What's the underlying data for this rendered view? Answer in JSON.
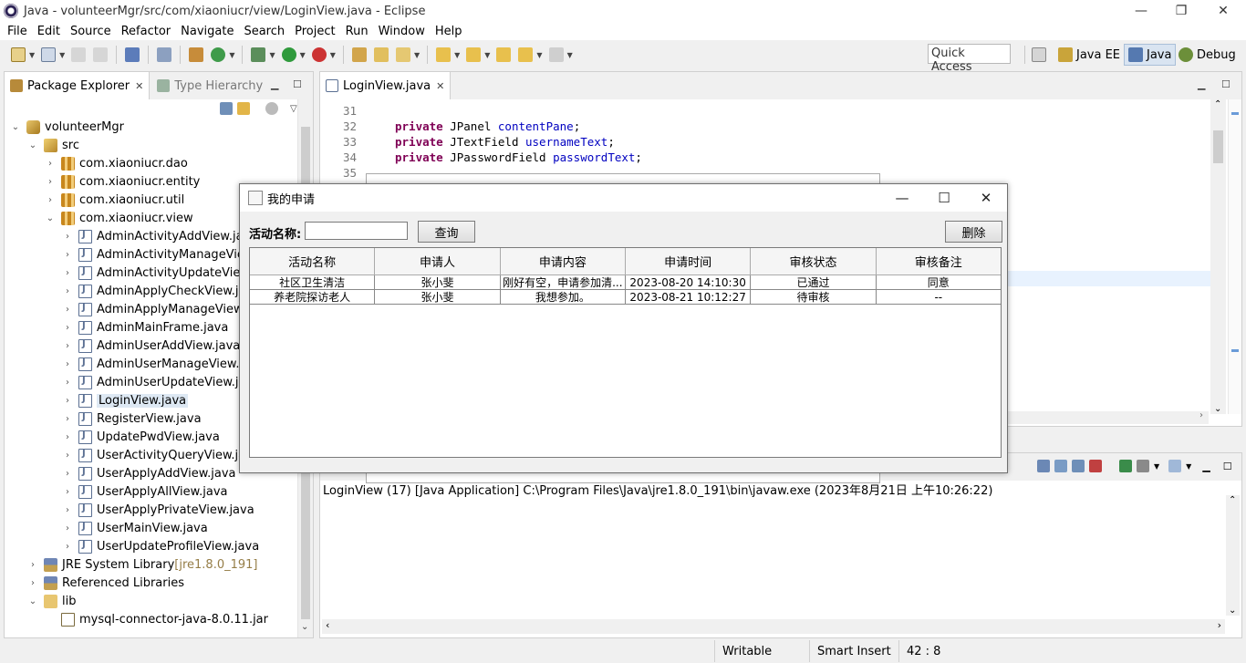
{
  "window": {
    "title": "Java - volunteerMgr/src/com/xiaoniucr/view/LoginView.java - Eclipse",
    "minimize": "—",
    "restore": "❐",
    "close": "✕"
  },
  "menu": [
    "File",
    "Edit",
    "Source",
    "Refactor",
    "Navigate",
    "Search",
    "Project",
    "Run",
    "Window",
    "Help"
  ],
  "toolbar": {
    "quick_access": "Quick Access",
    "perspectives": [
      "Java EE",
      "Java",
      "Debug"
    ]
  },
  "explorer": {
    "tab_active": "Package Explorer",
    "tab_inactive": "Type Hierarchy",
    "nodes": [
      {
        "label": "volunteerMgr",
        "toggle": "⌄",
        "icon": "project-icon"
      },
      {
        "label": "src",
        "toggle": "⌄",
        "icon": "source-folder-icon"
      },
      {
        "label": "com.xiaoniucr.dao",
        "toggle": "›",
        "icon": "package-icon"
      },
      {
        "label": "com.xiaoniucr.entity",
        "toggle": "›",
        "icon": "package-icon"
      },
      {
        "label": "com.xiaoniucr.util",
        "toggle": "›",
        "icon": "package-icon"
      },
      {
        "label": "com.xiaoniucr.view",
        "toggle": "⌄",
        "icon": "package-icon"
      },
      {
        "label": "AdminActivityAddView.java",
        "toggle": "›",
        "icon": "java-file-icon"
      },
      {
        "label": "AdminActivityManageView.java",
        "toggle": "›",
        "icon": "java-file-icon"
      },
      {
        "label": "AdminActivityUpdateView.java",
        "toggle": "›",
        "icon": "java-file-icon"
      },
      {
        "label": "AdminApplyCheckView.java",
        "toggle": "›",
        "icon": "java-file-icon"
      },
      {
        "label": "AdminApplyManageView.java",
        "toggle": "›",
        "icon": "java-file-icon"
      },
      {
        "label": "AdminMainFrame.java",
        "toggle": "›",
        "icon": "java-file-icon"
      },
      {
        "label": "AdminUserAddView.java",
        "toggle": "›",
        "icon": "java-file-icon"
      },
      {
        "label": "AdminUserManageView.java",
        "toggle": "›",
        "icon": "java-file-icon"
      },
      {
        "label": "AdminUserUpdateView.java",
        "toggle": "›",
        "icon": "java-file-icon"
      },
      {
        "label": "LoginView.java",
        "toggle": "›",
        "icon": "java-file-icon",
        "selected": true
      },
      {
        "label": "RegisterView.java",
        "toggle": "›",
        "icon": "java-file-icon"
      },
      {
        "label": "UpdatePwdView.java",
        "toggle": "›",
        "icon": "java-file-icon"
      },
      {
        "label": "UserActivityQueryView.java",
        "toggle": "›",
        "icon": "java-file-icon"
      },
      {
        "label": "UserApplyAddView.java",
        "toggle": "›",
        "icon": "java-file-icon"
      },
      {
        "label": "UserApplyAllView.java",
        "toggle": "›",
        "icon": "java-file-icon"
      },
      {
        "label": "UserApplyPrivateView.java",
        "toggle": "›",
        "icon": "java-file-icon"
      },
      {
        "label": "UserMainView.java",
        "toggle": "›",
        "icon": "java-file-icon"
      },
      {
        "label": "UserUpdateProfileView.java",
        "toggle": "›",
        "icon": "java-file-icon"
      },
      {
        "label": "JRE System Library",
        "suffix": " [jre1.8.0_191]",
        "toggle": "›",
        "icon": "library-icon"
      },
      {
        "label": "Referenced Libraries",
        "toggle": "›",
        "icon": "library-icon"
      },
      {
        "label": "lib",
        "toggle": "⌄",
        "icon": "folder-icon"
      },
      {
        "label": "mysql-connector-java-8.0.11.jar",
        "toggle": "",
        "icon": "jar-icon"
      }
    ]
  },
  "editor": {
    "tab": "LoginView.java",
    "lines": [
      {
        "num": "31",
        "kw": "",
        "type": "",
        "field": ""
      },
      {
        "num": "32",
        "kw": "private",
        "type": " JPanel ",
        "field": "contentPane",
        "end": ";"
      },
      {
        "num": "33",
        "kw": "private",
        "type": " JTextField ",
        "field": "usernameText",
        "end": ";"
      },
      {
        "num": "34",
        "kw": "private",
        "type": " JPasswordField ",
        "field": "passwordText",
        "end": ";"
      },
      {
        "num": "35",
        "kw": "",
        "type": "",
        "field": "",
        "end": ""
      }
    ]
  },
  "console": {
    "header": "LoginView (17) [Java Application] C:\\Program Files\\Java\\jre1.8.0_191\\bin\\javaw.exe (2023年8月21日 上午10:26:22)"
  },
  "status": {
    "writable": "Writable",
    "insert_mode": "Smart Insert",
    "position": "42 : 8"
  },
  "dialog": {
    "title": "我的申请",
    "search_label": "活动名称:",
    "search_value": "",
    "query_button": "查询",
    "delete_button": "删除",
    "columns": [
      "活动名称",
      "申请人",
      "申请内容",
      "申请时间",
      "审核状态",
      "审核备注"
    ],
    "rows": [
      [
        "社区卫生清洁",
        "张小斐",
        "刚好有空，申请参加清...",
        "2023-08-20 14:10:30",
        "已通过",
        "同意"
      ],
      [
        "养老院探访老人",
        "张小斐",
        "我想参加。",
        "2023-08-21 10:12:27",
        "待审核",
        "--"
      ]
    ]
  }
}
